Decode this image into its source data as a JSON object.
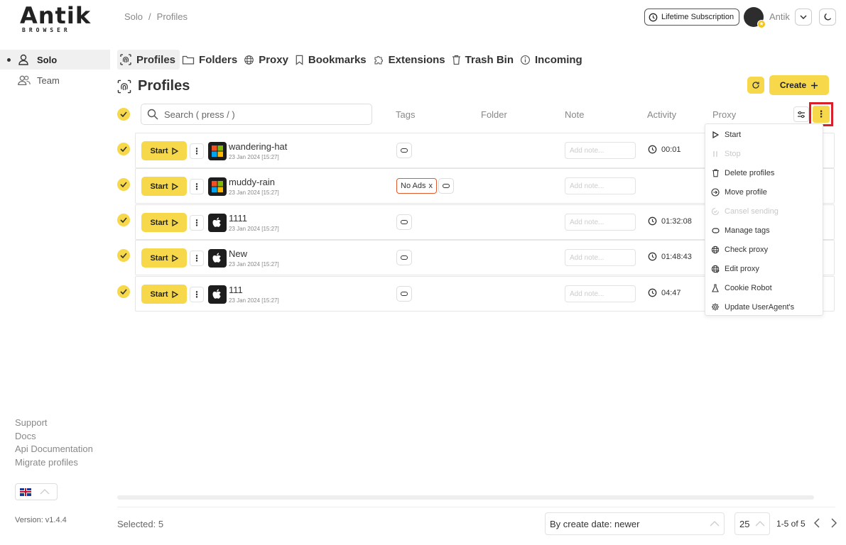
{
  "logo": {
    "main": "Antik",
    "sub": "BROWSER"
  },
  "breadcrumb": [
    "Solo",
    "Profiles"
  ],
  "header": {
    "subscription": "Lifetime Subscription",
    "user_name": "Antik"
  },
  "sidebar": {
    "items": [
      {
        "label": "Solo",
        "icon": "user-icon",
        "active": true
      },
      {
        "label": "Team",
        "icon": "users-icon",
        "active": false
      }
    ],
    "links": [
      "Support",
      "Docs",
      "Api Documentation",
      "Migrate profiles"
    ],
    "version": "Version: v1.4.4"
  },
  "nav": {
    "tabs": [
      {
        "label": "Profiles",
        "icon": "fingerprint-icon"
      },
      {
        "label": "Folders",
        "icon": "folder-icon"
      },
      {
        "label": "Proxy",
        "icon": "globe-icon"
      },
      {
        "label": "Bookmarks",
        "icon": "bookmark-icon"
      },
      {
        "label": "Extensions",
        "icon": "puzzle-icon"
      },
      {
        "label": "Trash Bin",
        "icon": "trash-icon"
      },
      {
        "label": "Incoming",
        "icon": "info-icon"
      }
    ]
  },
  "page": {
    "title": "Profiles",
    "create_label": "Create"
  },
  "search": {
    "placeholder": "Search ( press / )"
  },
  "columns": {
    "tags": "Tags",
    "folder": "Folder",
    "note": "Note",
    "activity": "Activity",
    "proxy": "Proxy"
  },
  "start_label": "Start",
  "note_placeholder": "Add note...",
  "profiles": [
    {
      "name": "wandering-hat",
      "date": "23 Jan 2024 [15:27]",
      "os": "windows",
      "tags": [],
      "activity": "00:01"
    },
    {
      "name": "muddy-rain",
      "date": "23 Jan 2024 [15:27]",
      "os": "windows",
      "tags": [
        "No Ads"
      ],
      "activity": ""
    },
    {
      "name": "1111",
      "date": "23 Jan 2024 [15:27]",
      "os": "macos",
      "tags": [],
      "activity": "01:32:08"
    },
    {
      "name": "New",
      "date": "23 Jan 2024 [15:27]",
      "os": "macos",
      "tags": [],
      "activity": "01:48:43"
    },
    {
      "name": "111",
      "date": "23 Jan 2024 [15:27]",
      "os": "macos",
      "tags": [],
      "activity": "04:47"
    }
  ],
  "menu": {
    "items": [
      {
        "label": "Start",
        "icon": "play-icon",
        "disabled": false
      },
      {
        "label": "Stop",
        "icon": "pause-icon",
        "disabled": true
      },
      {
        "label": "Delete profiles",
        "icon": "trash-icon",
        "disabled": false
      },
      {
        "label": "Move profile",
        "icon": "arrow-circle-icon",
        "disabled": false
      },
      {
        "label": "Cansel sending",
        "icon": "cancel-sending-icon",
        "disabled": true
      },
      {
        "label": "Manage tags",
        "icon": "tag-icon",
        "disabled": false
      },
      {
        "label": "Check proxy",
        "icon": "globe-icon",
        "disabled": false
      },
      {
        "label": "Edit proxy",
        "icon": "globe-edit-icon",
        "disabled": false
      },
      {
        "label": "Cookie Robot",
        "icon": "flask-icon",
        "disabled": false
      },
      {
        "label": "Update UserAgent's",
        "icon": "gear-icon",
        "disabled": false
      }
    ]
  },
  "footer": {
    "selected": "Selected: 5",
    "sort": "By create date: newer",
    "per_page": "25",
    "range": "1-5 of 5"
  },
  "colors": {
    "accent": "#f7d84b",
    "highlight": "#d81f2a",
    "tag_border": "#e05a2b"
  }
}
